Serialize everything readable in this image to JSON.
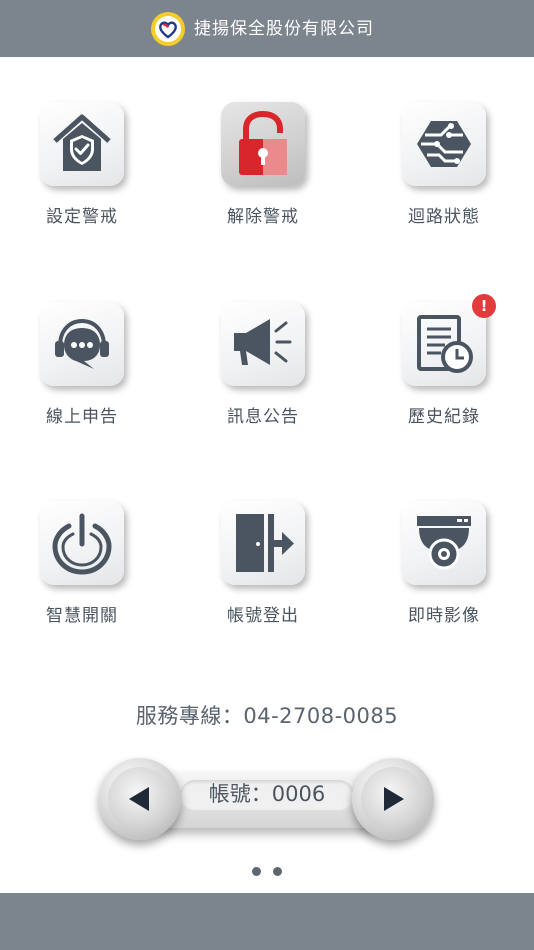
{
  "header": {
    "company_name": "捷揚保全股份有限公司",
    "bar_color": "#7c858e",
    "logo_icon": "heart-logo-icon"
  },
  "grid": {
    "items": [
      {
        "label": "設定警戒",
        "icon": "house-shield-icon"
      },
      {
        "label": "解除警戒",
        "icon": "unlocked-padlock-icon",
        "active": true
      },
      {
        "label": "迴路狀態",
        "icon": "circuit-chip-icon"
      },
      {
        "label": "線上申告",
        "icon": "headset-chat-icon"
      },
      {
        "label": "訊息公告",
        "icon": "megaphone-icon"
      },
      {
        "label": "歷史紀錄",
        "icon": "document-clock-icon",
        "badge": "!"
      },
      {
        "label": "智慧開關",
        "icon": "power-icon"
      },
      {
        "label": "帳號登出",
        "icon": "logout-door-icon"
      },
      {
        "label": "即時影像",
        "icon": "security-camera-icon"
      }
    ]
  },
  "hotline": {
    "text": "服務專線：04-2708-0085"
  },
  "account": {
    "text": "帳號：0006",
    "prev_icon": "triangle-left-icon",
    "next_icon": "triangle-right-icon"
  },
  "pager": {
    "pages": 2,
    "current": 1
  },
  "colors": {
    "icon_dark": "#4a5561",
    "lock_red": "#d9262b",
    "badge_red": "#e23b3b"
  }
}
